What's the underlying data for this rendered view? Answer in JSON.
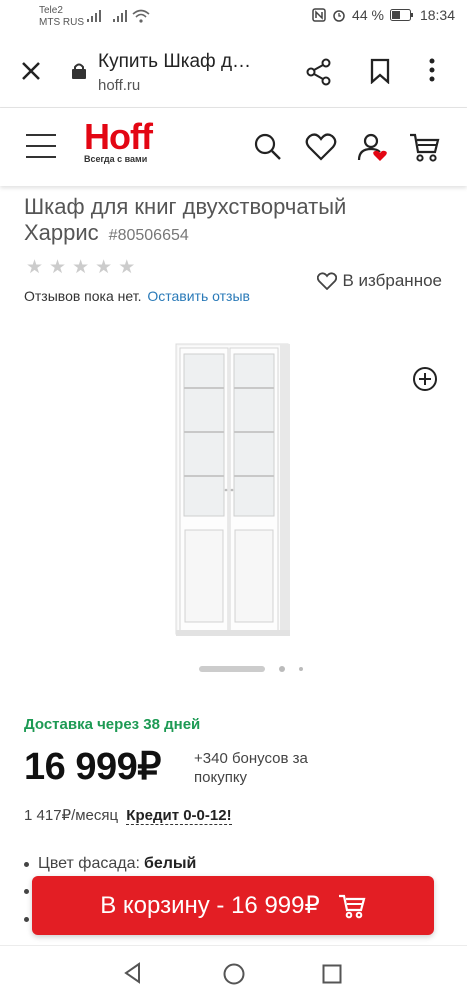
{
  "status": {
    "carrier_1": "Tele2",
    "carrier_2": "MTS RUS",
    "battery": "44 %",
    "time": "18:34"
  },
  "browser": {
    "title": "Купить Шкаф д…",
    "url": "hoff.ru"
  },
  "site": {
    "logo": "Hoff",
    "tagline": "Всегда с вами"
  },
  "product": {
    "title": "Шкаф для книг двухстворчатый Харрис",
    "sku": "#80506654",
    "rating": 0,
    "favorite_label": "В избранное",
    "reviews_text": "Отзывов пока нет.",
    "leave_review": "Оставить отзыв",
    "delivery": "Доставка через 38 дней",
    "price": "16 999₽",
    "bonus": "+340 бонусов за покупку",
    "monthly": "1 417₽/месяц",
    "credit": "Кредит 0-0-12!",
    "attr_label": "Цвет фасада:",
    "attr_value": "белый",
    "cart_button": "В корзину - 16 999₽"
  },
  "gallery": {
    "current_slide": 1,
    "slides": 3
  },
  "colors": {
    "brand_red": "#e30613",
    "delivery_green": "#1d9a54",
    "link_blue": "#2a7ab8"
  }
}
